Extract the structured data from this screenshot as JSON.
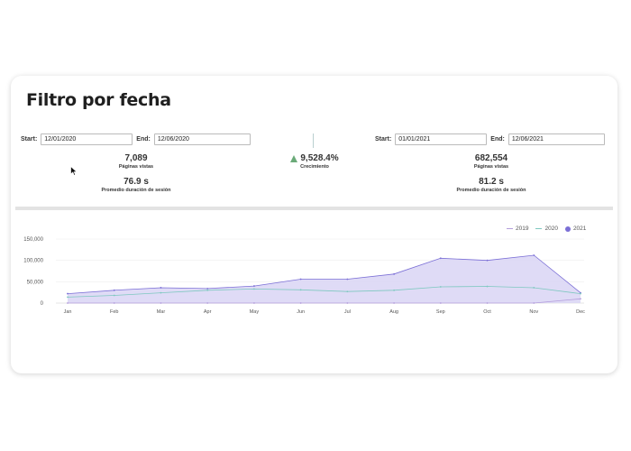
{
  "page": {
    "title": "Filtro por fecha"
  },
  "range_left": {
    "start_label": "Start:",
    "start_value": "12/01/2020",
    "end_label": "End:",
    "end_value": "12/06/2020",
    "pages": "7,089",
    "pages_label": "Páginas vistas",
    "duration": "76.9 s",
    "duration_label": "Promedio duración de sesión"
  },
  "range_right": {
    "start_label": "Start:",
    "start_value": "01/01/2021",
    "end_label": "End:",
    "end_value": "12/06/2021",
    "pages": "682,554",
    "pages_label": "Páginas vistas",
    "duration": "81.2 s",
    "duration_label": "Promedio duración de sesión"
  },
  "growth": {
    "value": "9,528.4%",
    "label": "Crecimiento",
    "icon": "triangle-up-icon",
    "color": "#6aaa78"
  },
  "chart_data": {
    "type": "area",
    "categories": [
      "Jan",
      "Feb",
      "Mar",
      "Apr",
      "May",
      "Jun",
      "Jul",
      "Aug",
      "Sep",
      "Oct",
      "Nov",
      "Dec"
    ],
    "ylim": [
      0,
      150000
    ],
    "yticks": [
      0,
      50000,
      100000,
      150000
    ],
    "ytick_labels": [
      "0",
      "50,000",
      "100,000",
      "150,000"
    ],
    "grid": true,
    "legend_position": "top-right",
    "series": [
      {
        "name": "2019",
        "color": "#b39ddb",
        "style": "line",
        "values": [
          0,
          0,
          0,
          0,
          0,
          0,
          0,
          0,
          0,
          0,
          0,
          10000
        ]
      },
      {
        "name": "2020",
        "color": "#7ec8c0",
        "style": "line",
        "values": [
          14000,
          18000,
          24000,
          30000,
          33000,
          31000,
          27000,
          30000,
          38000,
          39000,
          36000,
          22000
        ]
      },
      {
        "name": "2021",
        "color": "#7b6fd6",
        "fill": "#d9d5f5",
        "style": "area",
        "values": [
          22000,
          30000,
          36000,
          34000,
          40000,
          56000,
          56000,
          68000,
          105000,
          100000,
          112000,
          24000
        ]
      }
    ]
  }
}
